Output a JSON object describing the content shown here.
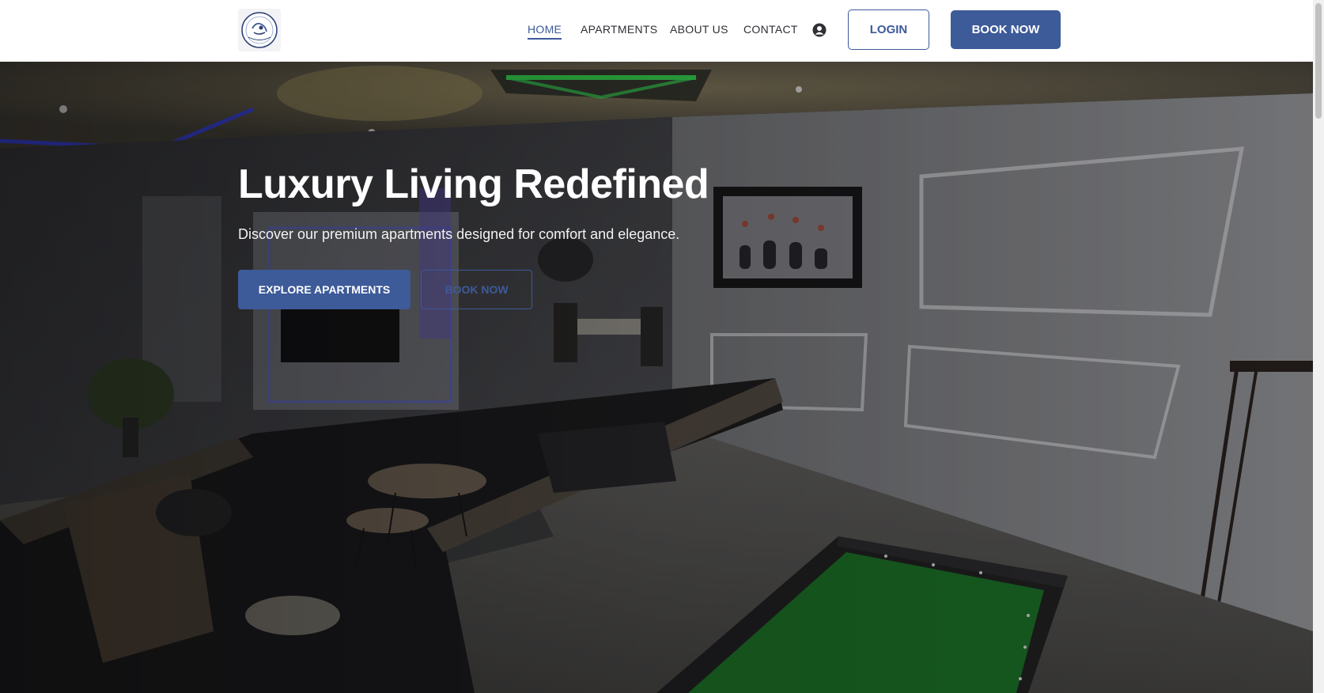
{
  "brand": {
    "logo_icon": "brand-logo-emblem"
  },
  "nav": {
    "items": [
      {
        "label": "HOME",
        "active": true
      },
      {
        "label": "APARTMENTS",
        "active": false
      },
      {
        "label": "ABOUT US",
        "active": false
      },
      {
        "label": "CONTACT",
        "active": false
      }
    ],
    "user_icon": "user-circle-icon",
    "login_label": "LOGIN",
    "book_label": "BOOK NOW"
  },
  "hero": {
    "title": "Luxury Living Redefined",
    "subtitle": "Discover our premium apartments designed for comfort and elegance.",
    "primary_cta": "EXPLORE APARTMENTS",
    "secondary_cta": "BOOK NOW"
  },
  "colors": {
    "accent": "#3d5a99",
    "white": "#ffffff",
    "text_dark": "#2f2f35"
  }
}
